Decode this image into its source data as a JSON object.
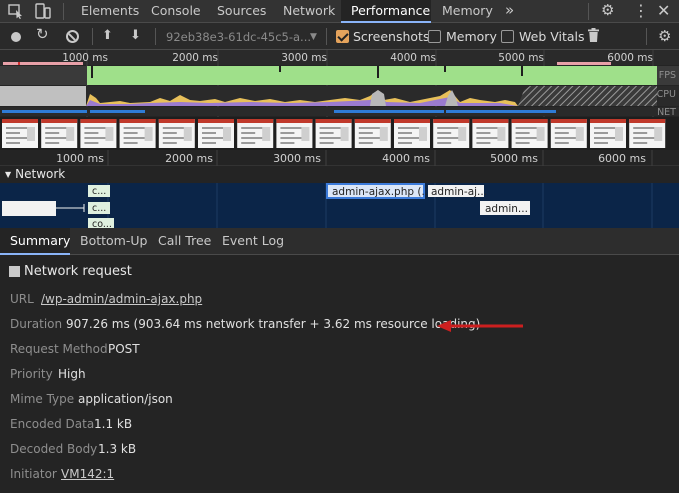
{
  "tabs": {
    "items": [
      {
        "label": "Elements",
        "active": false
      },
      {
        "label": "Console",
        "active": false
      },
      {
        "label": "Sources",
        "active": false
      },
      {
        "label": "Network",
        "active": false
      },
      {
        "label": "Performance",
        "active": true
      },
      {
        "label": "Memory",
        "active": false
      }
    ],
    "more_label": "»"
  },
  "toolbar": {
    "profile_select_value": "92eb38e3-61dc-45c5-a...",
    "screenshots_label": "Screenshots",
    "screenshots_checked": true,
    "memory_label": "Memory",
    "memory_checked": false,
    "web_vitals_label": "Web Vitals",
    "web_vitals_checked": false
  },
  "overview": {
    "tick_labels": [
      "1000 ms",
      "2000 ms",
      "3000 ms",
      "4000 ms",
      "5000 ms",
      "6000 ms"
    ],
    "track_labels": {
      "fps": "FPS",
      "cpu": "CPU",
      "net": "NET"
    }
  },
  "ruler": {
    "tick_labels": [
      "1000 ms",
      "2000 ms",
      "3000 ms",
      "4000 ms",
      "5000 ms",
      "6000 ms"
    ]
  },
  "network_track": {
    "title": "Network",
    "requests": [
      {
        "label": "c..."
      },
      {
        "label": "c..."
      },
      {
        "label": "co..."
      },
      {
        "label": "admin-ajax.php (..."
      },
      {
        "label": "admin-aj..."
      },
      {
        "label": "admin..."
      }
    ]
  },
  "bottom_tabs": [
    {
      "label": "Summary",
      "active": true
    },
    {
      "label": "Bottom-Up",
      "active": false
    },
    {
      "label": "Call Tree",
      "active": false
    },
    {
      "label": "Event Log",
      "active": false
    }
  ],
  "summary": {
    "title": "Network request",
    "rows": [
      {
        "key": "URL",
        "value": "/wp-admin/admin-ajax.php",
        "link": true
      },
      {
        "key": "Duration",
        "value": "907.26 ms (903.64 ms network transfer + 3.62 ms resource loading)",
        "link": false
      },
      {
        "key": "Request Method",
        "value": "POST",
        "link": false
      },
      {
        "key": "Priority",
        "value": "High",
        "link": false
      },
      {
        "key": "Mime Type",
        "value": "application/json",
        "link": false
      },
      {
        "key": "Encoded Data",
        "value": "1.1 kB",
        "link": false
      },
      {
        "key": "Decoded Body",
        "value": "1.3 kB",
        "link": false
      },
      {
        "key": "Initiator",
        "value": "VM142:1",
        "link": true
      }
    ]
  },
  "colors": {
    "active_tab_underline": "#8ab4f8",
    "fps_green": "#9fe08a",
    "cpu_yellow": "#e8c05a",
    "cpu_purple": "#9b7bd0",
    "net_blue": "#2f7bd6",
    "network_track_bg": "#0b2548",
    "arrow_red": "#cc1f1f",
    "checkbox_orange": "#e4a35c"
  }
}
